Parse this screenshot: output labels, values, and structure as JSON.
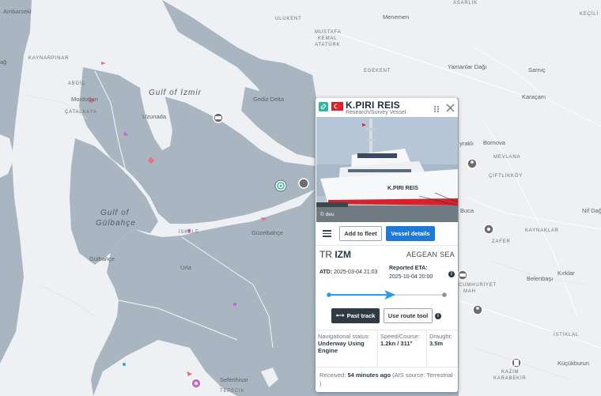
{
  "map": {
    "labels": {
      "gulf_izmir": "Gulf of İzmir",
      "gulf_gulbahce_1": "Gulf of",
      "gulf_gulbahce_2": "Gülbahçe",
      "ambarseki": "Ambarseki",
      "kaynarpinar": "KAYNARPINAR",
      "aliaga_partial": "ağ",
      "abdic": "ABDİÇ",
      "mordogan": "Mordoğan",
      "catalkaya": "ÇATALKAYA",
      "uzunada": "Uzunada",
      "gediz_delta": "Gediz Delta",
      "ulukent": "ULUKENT",
      "mustafa_kemal_1": "MUSTAFA",
      "mustafa_kemal_2": "KEMAL",
      "mustafa_kemal_3": "ATATÜRK",
      "menemen": "Menemen",
      "asarlik": "ASARLIK",
      "yamanlar": "Yamanlar Dağı",
      "egekent": "EGEKENT",
      "sarnic": "Sarnıç",
      "karacam": "Karaçam",
      "bayrakli": "yraklı",
      "bornova": "Bornova",
      "mevlana": "MEVLANA",
      "ciftlikkoy": "ÇİFTLİKKÖY",
      "nif_dagi": "Nif Dağı",
      "buca": "Buca",
      "kaynaklar": "KAYNAKLAR",
      "zafer": "ZAFER",
      "kirklar": "Kırklar",
      "belenbasi": "Belenbaşı",
      "cumhuriyet_1": "CUMHURİYET",
      "cumhuriyet_2": "MAH",
      "iskele": "İSKELE",
      "guzelbahce": "Güzelbahçe",
      "gulbahce": "Gülbahçe",
      "urla": "Urla",
      "seferihisar": "Seferihisar",
      "tepecik": "TEPECİK",
      "istiklal": "İSTİKLAL",
      "kazim_1": "KAZIM",
      "kazim_2": "KARABEKİR",
      "kucukburun": "Küçükburun",
      "kecili": "KEÇİLİ"
    },
    "colors": {
      "water": "#a9b6c2",
      "land": "#eef0f3",
      "vessel_passenger": "#3c9ce8",
      "vessel_cargo": "#e7707f",
      "vessel_other": "#c667d0"
    }
  },
  "popup": {
    "vessel_name": "K.PIRI REIS",
    "vessel_type": "Research/Survey Vessel",
    "flag": "Turkey",
    "photo_credit": "© deu",
    "ship_hull_text": "K.PIRI REIS",
    "buttons": {
      "add_to_fleet": "Add to fleet",
      "vessel_details": "Vessel details",
      "past_track": "Past track",
      "use_route_tool": "Use route tool"
    },
    "route": {
      "from_country": "TR",
      "from_port": "IZM",
      "to": "AEGEAN SEA"
    },
    "atd_label": "ATD:",
    "atd_value": "2025-03-04 21:03",
    "eta_label": "Reported ETA:",
    "eta_value": "2025-10-04 20:00",
    "progress_fraction": 0.53,
    "stats": {
      "nav_status_label": "Navigational status:",
      "nav_status_value": "Underway Using Engine",
      "speed_label": "Speed/Course:",
      "speed_value": "1.2kn / 311°",
      "draught_label": "Draught:",
      "draught_value": "3.5m"
    },
    "received_label": "Received:",
    "received_value": "54 minutes ago",
    "received_source": "(AIS source: Terrestrial )",
    "icons": {
      "link": "link-icon",
      "drag": "drag-handle-icon",
      "close": "close-icon",
      "menu": "hamburger-menu-icon",
      "info": "info-icon",
      "track": "track-icon"
    }
  }
}
